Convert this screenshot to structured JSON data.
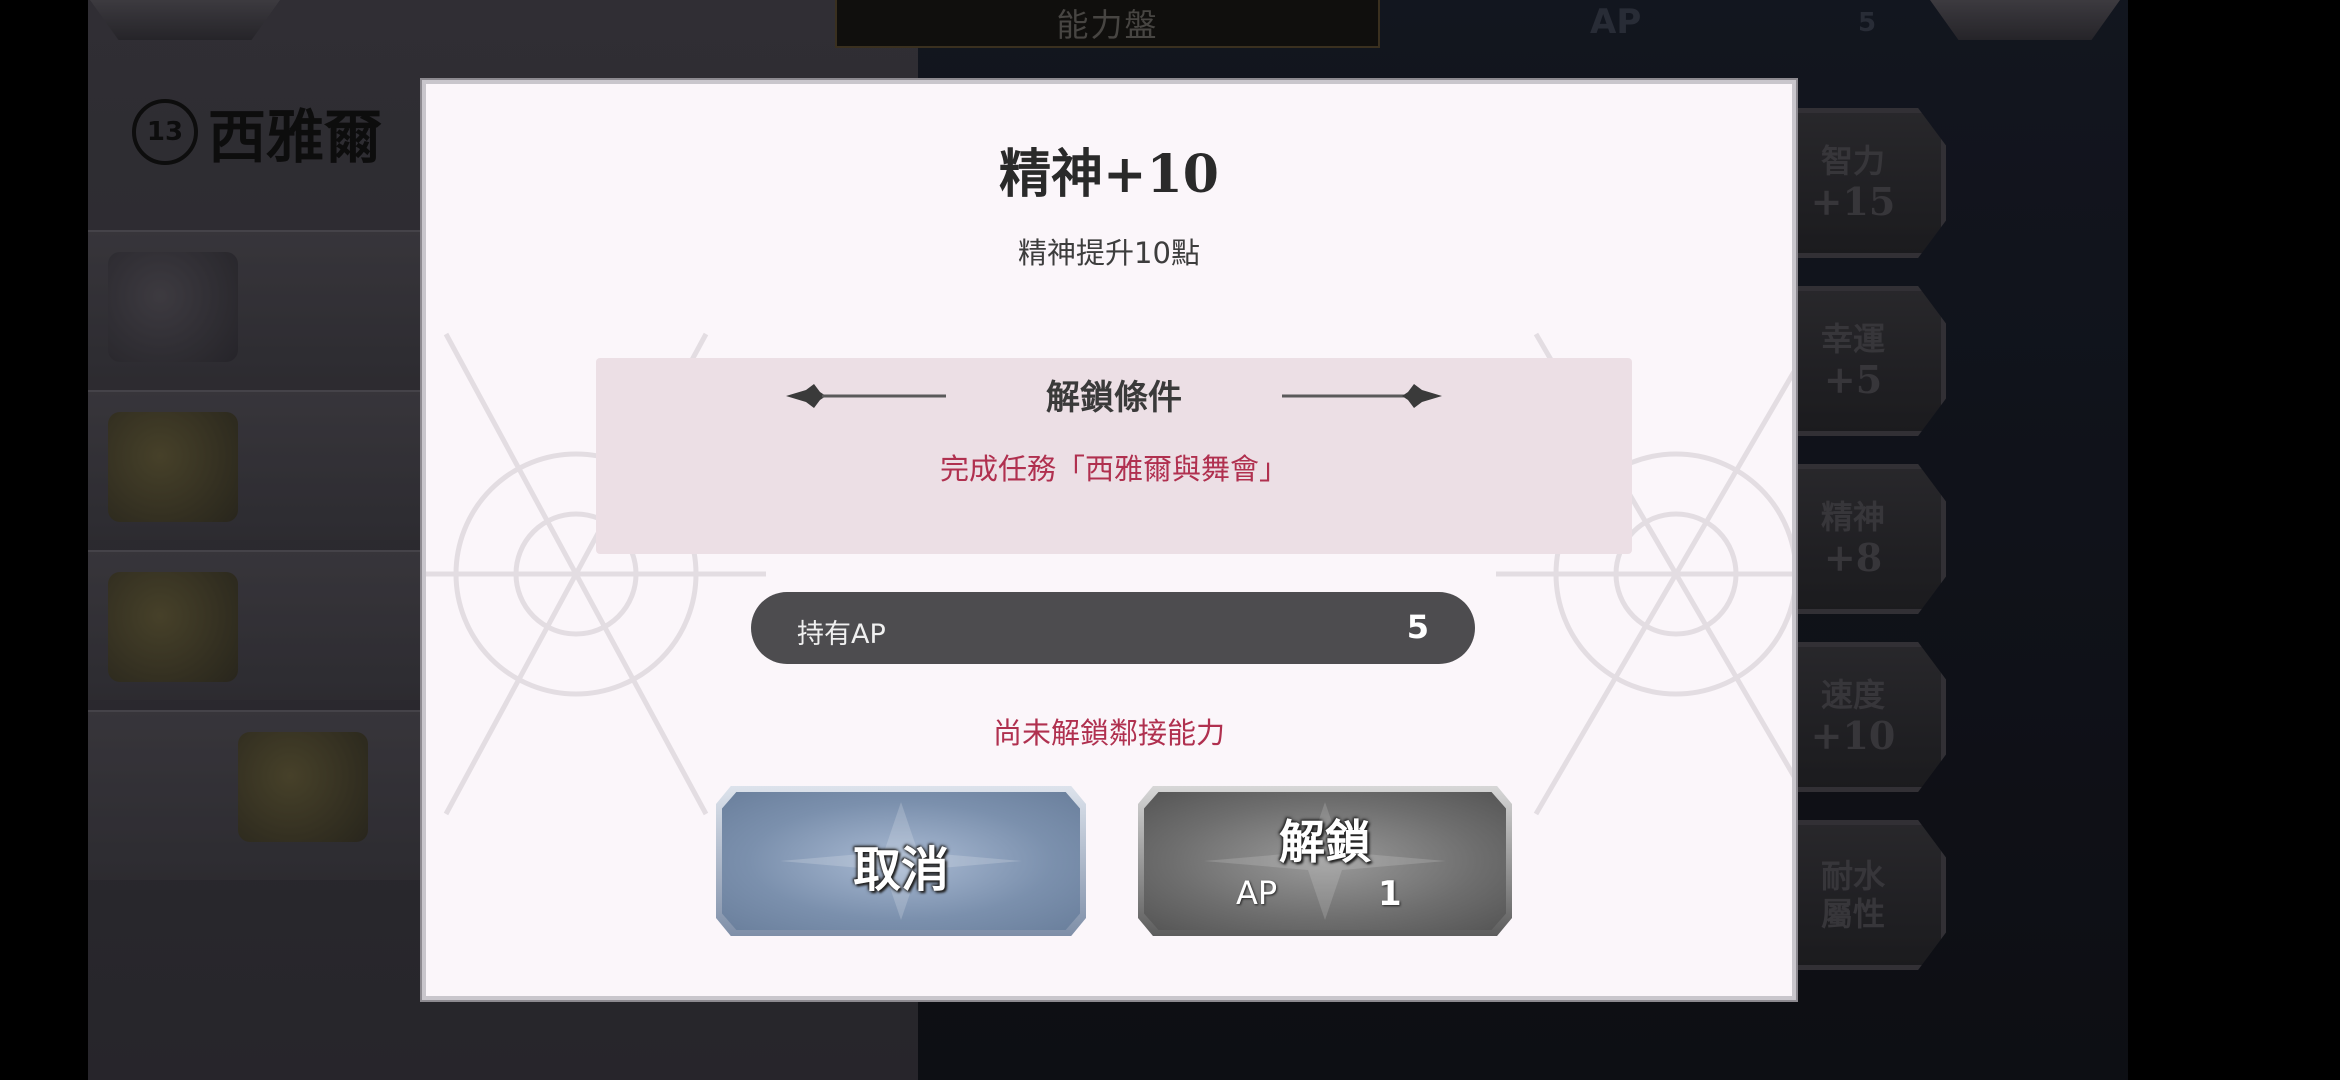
{
  "background": {
    "board_title": "能力盤",
    "top_ap_label": "AP",
    "top_ap_value": "5",
    "character_emblem": "13",
    "character_name": "西雅爾",
    "stat_nodes": [
      {
        "name": "智力",
        "value": "+15"
      },
      {
        "name": "幸運",
        "value": "+5"
      },
      {
        "name": "精神",
        "value": "+8"
      },
      {
        "name": "速度",
        "value": "+10"
      },
      {
        "name": "耐水",
        "value": "屬性"
      }
    ]
  },
  "dialog": {
    "title": "精神+10",
    "description": "精神提升10點",
    "condition_header": "解鎖條件",
    "condition_text": "完成任務「西雅爾與舞會」",
    "ap_label": "持有AP",
    "ap_value": "5",
    "note": "尚未解鎖鄰接能力",
    "cancel_label": "取消",
    "unlock_label": "解鎖",
    "unlock_cost_label": "AP",
    "unlock_cost_value": "1"
  },
  "colors": {
    "accent_red": "#b0304f",
    "ap_bar": "#4d4c4f",
    "dialog_bg": "#fbf6fa"
  }
}
